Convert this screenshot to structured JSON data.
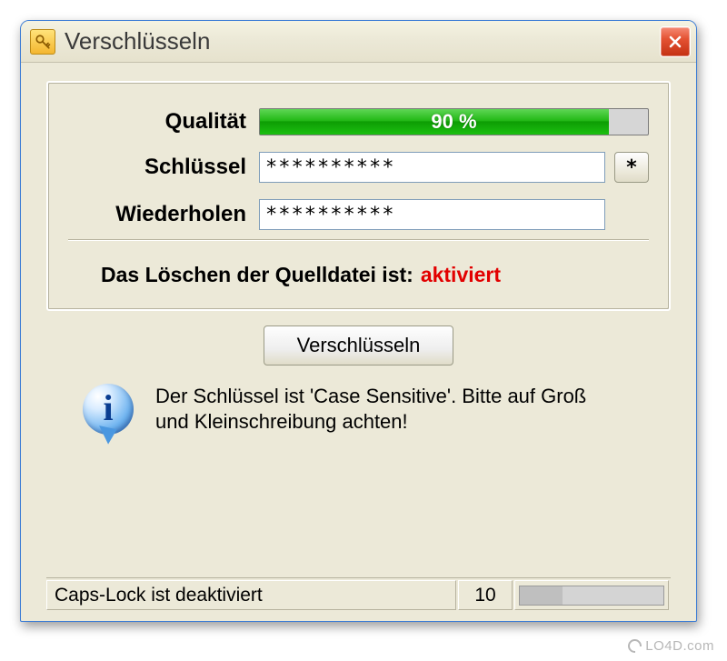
{
  "window": {
    "title": "Verschlüsseln"
  },
  "form": {
    "quality": {
      "label": "Qualität",
      "percent_text": "90 %",
      "percent_value": 90
    },
    "key": {
      "label": "Schlüssel",
      "value": "**********"
    },
    "repeat": {
      "label": "Wiederholen",
      "value": "**********"
    },
    "reveal_button": "*"
  },
  "delete_status": {
    "label": "Das Löschen der Quelldatei ist:",
    "value": "aktiviert"
  },
  "action": {
    "encrypt_button": "Verschlüsseln"
  },
  "info": {
    "text": "Der Schlüssel ist 'Case Sensitive'. Bitte auf Groß und Kleinschreibung achten!"
  },
  "statusbar": {
    "capslock": "Caps-Lock ist deaktiviert",
    "count": "10"
  },
  "watermark": "LO4D.com"
}
